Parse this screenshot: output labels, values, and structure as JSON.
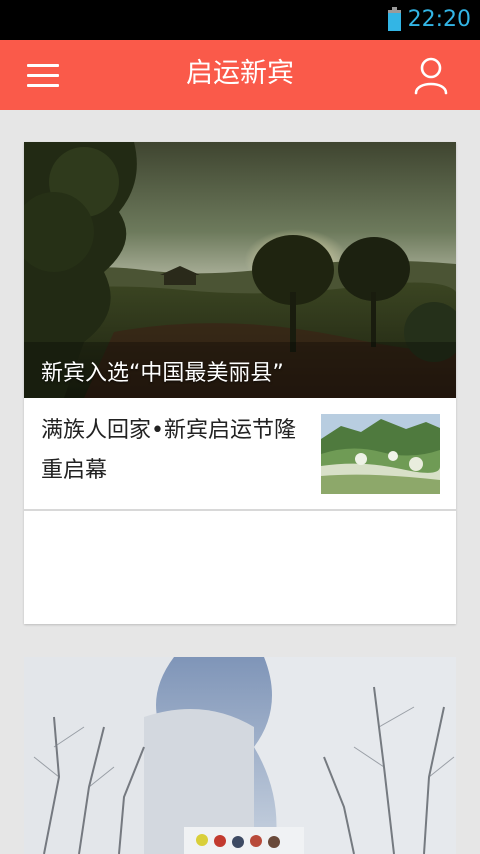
{
  "status_bar": {
    "time": "22:20",
    "battery_level": 0.85,
    "battery_icon": "battery-icon"
  },
  "app_bar": {
    "title": "启运新宾",
    "menu_icon": "menu-icon",
    "user_icon": "user-icon",
    "color": "#fa5a4a"
  },
  "feed": {
    "featured": {
      "caption": "新宾入选“中国最美丽县”"
    },
    "items": [
      {
        "title": "满族人回家•新宾启运节隆重启幕"
      }
    ]
  },
  "colors": {
    "status_accent": "#33b5e5",
    "background": "#e6e6e6"
  }
}
